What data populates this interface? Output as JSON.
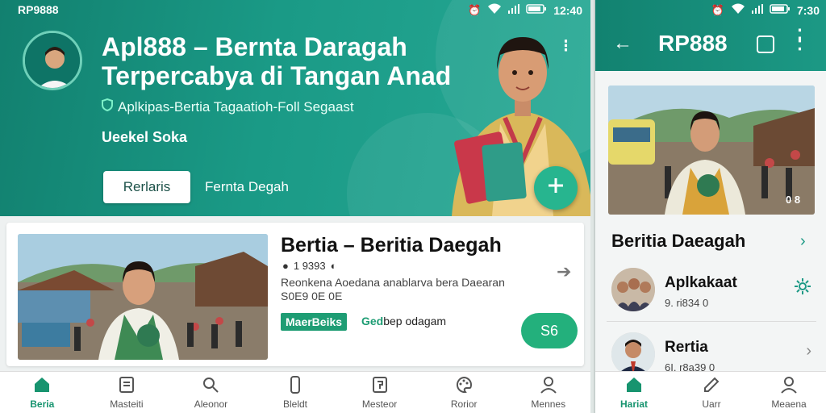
{
  "left": {
    "status": {
      "carrier": "RP9888",
      "time": "12:40"
    },
    "hero": {
      "title": "Apl888 – Bernta Daragah Terpercabya di Tangan Anad",
      "subtitle": "Aplkipas-Bertia Tagaatioh-Foll Segaast",
      "tagline": "Ueekel Soka",
      "primary_button": "Rerlaris",
      "secondary_button": "Fernta Degah",
      "fab_icon": "plus-icon"
    },
    "card": {
      "title": "Bertia – Beritia Daegah",
      "meta": "1 9393",
      "description": "Reonkena Aoedana anablarva bera Daearan S0E9 0E 0E",
      "tag": "MaerBeiks",
      "tag2_a": "Ged",
      "tag2_b": "bep odagam",
      "pill": "S6"
    },
    "nav": [
      {
        "label": "Beria",
        "icon": "home-icon",
        "active": true
      },
      {
        "label": "Masteiti",
        "icon": "list-icon",
        "active": false
      },
      {
        "label": "Aleonor",
        "icon": "search-icon",
        "active": false
      },
      {
        "label": "Bleldt",
        "icon": "phone-icon",
        "active": false
      },
      {
        "label": "Mesteor",
        "icon": "edit-icon",
        "active": false
      },
      {
        "label": "Rorior",
        "icon": "palette-icon",
        "active": false
      },
      {
        "label": "Mennes",
        "icon": "profile-icon",
        "active": false
      }
    ]
  },
  "right": {
    "status": {
      "time": "7:30"
    },
    "title": "RP888",
    "image_badge": "0 8",
    "section_title": "Beritia Daeagah",
    "rows": [
      {
        "name": "Aplkakaat",
        "meta": "9. ri834 0"
      },
      {
        "name": "Rertia",
        "meta": "6I. r8a39 0"
      }
    ],
    "nav": [
      {
        "label": "Hariat",
        "icon": "home-icon",
        "active": true
      },
      {
        "label": "Uarr",
        "icon": "edit-icon",
        "active": false
      },
      {
        "label": "Meaena",
        "icon": "profile-icon",
        "active": false
      }
    ]
  },
  "colors": {
    "primary": "#17946f",
    "hero_start": "#12806f",
    "accent": "#23b07c"
  }
}
